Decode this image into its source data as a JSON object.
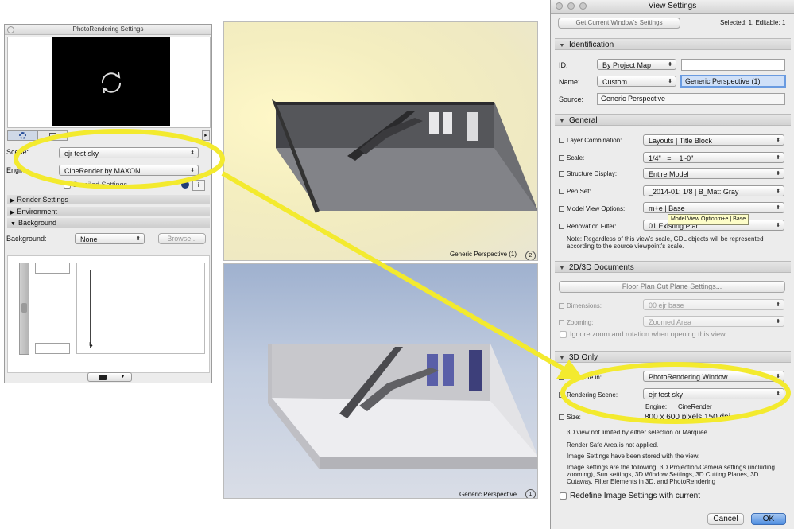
{
  "photo_window": {
    "title": "PhotoRendering Settings",
    "scene_label": "Scene:",
    "scene_value": "ejr test sky",
    "engine_label": "Engine:",
    "engine_value": "CineRender by MAXON",
    "detailed_label": "Detailed Settings",
    "sections": [
      "Render Settings",
      "Environment",
      "Background"
    ],
    "background_label": "Background:",
    "background_value": "None",
    "browse_label": "Browse..."
  },
  "renders": {
    "top_caption": "Generic Perspective (1)",
    "top_badge": "2",
    "bottom_caption": "Generic Perspective",
    "bottom_badge": "1"
  },
  "view_settings": {
    "title": "View Settings",
    "get_button": "Get Current Window's Settings",
    "selected": "Selected: 1, Editable: 1",
    "identification": {
      "header": "Identification",
      "id_label": "ID:",
      "id_popup": "By Project Map",
      "name_label": "Name:",
      "name_popup": "Custom",
      "name_value": "Generic Perspective (1)",
      "source_label": "Source:",
      "source_value": "Generic Perspective"
    },
    "general": {
      "header": "General",
      "layer_label": "Layer Combination:",
      "layer_value": "Layouts | Title Block",
      "scale_label": "Scale:",
      "scale_value": "1/4\"   =    1'-0\"",
      "structure_label": "Structure Display:",
      "structure_value": "Entire Model",
      "pen_label": "Pen Set:",
      "pen_value": "_2014-01: 1/8 | B_Mat: Gray",
      "mvo_label": "Model View Options:",
      "mvo_value": "m+e | Base",
      "tooltip": "Model View Optionm+e | Base",
      "reno_label": "Renovation Filter:",
      "reno_value": "01 Existing Plan",
      "note": "Note: Regardless of this view's scale, GDL objects will be represented according to the source viewpoint's scale."
    },
    "docs2d3d": {
      "header": "2D/3D Documents",
      "floor_button": "Floor Plan Cut Plane Settings...",
      "dims_label": "Dimensions:",
      "dims_value": "00 ejr base",
      "zoom_label": "Zooming:",
      "zoom_value": "Zoomed Area",
      "ignore_label": "Ignore zoom and rotation when opening this view"
    },
    "only3d": {
      "header": "3D Only",
      "generate_label": "Generate in:",
      "generate_value": "PhotoRendering Window",
      "scene_label": "Rendering Scene:",
      "scene_value": "ejr test sky",
      "engine_label": "Engine:",
      "engine_value": "CineRender",
      "size_label": "Size:",
      "size_value": "800 x 600 pixels 150 dpi",
      "line1": "3D view not limited by either selection or Marquee.",
      "line2": "Render Safe Area is not applied.",
      "line3": "Image Settings have been stored with the view.",
      "line4": "Image settings are the following: 3D Projection/Camera settings (including zooming), Sun settings, 3D Window Settings, 3D Cutting Planes, 3D Cutaway, Filter Elements in 3D, and PhotoRendering",
      "redefine_label": "Redefine Image Settings with current"
    },
    "cancel": "Cancel",
    "ok": "OK"
  },
  "colors": {
    "highlight": "#f3ea2e",
    "accent": "#3b78d8"
  }
}
